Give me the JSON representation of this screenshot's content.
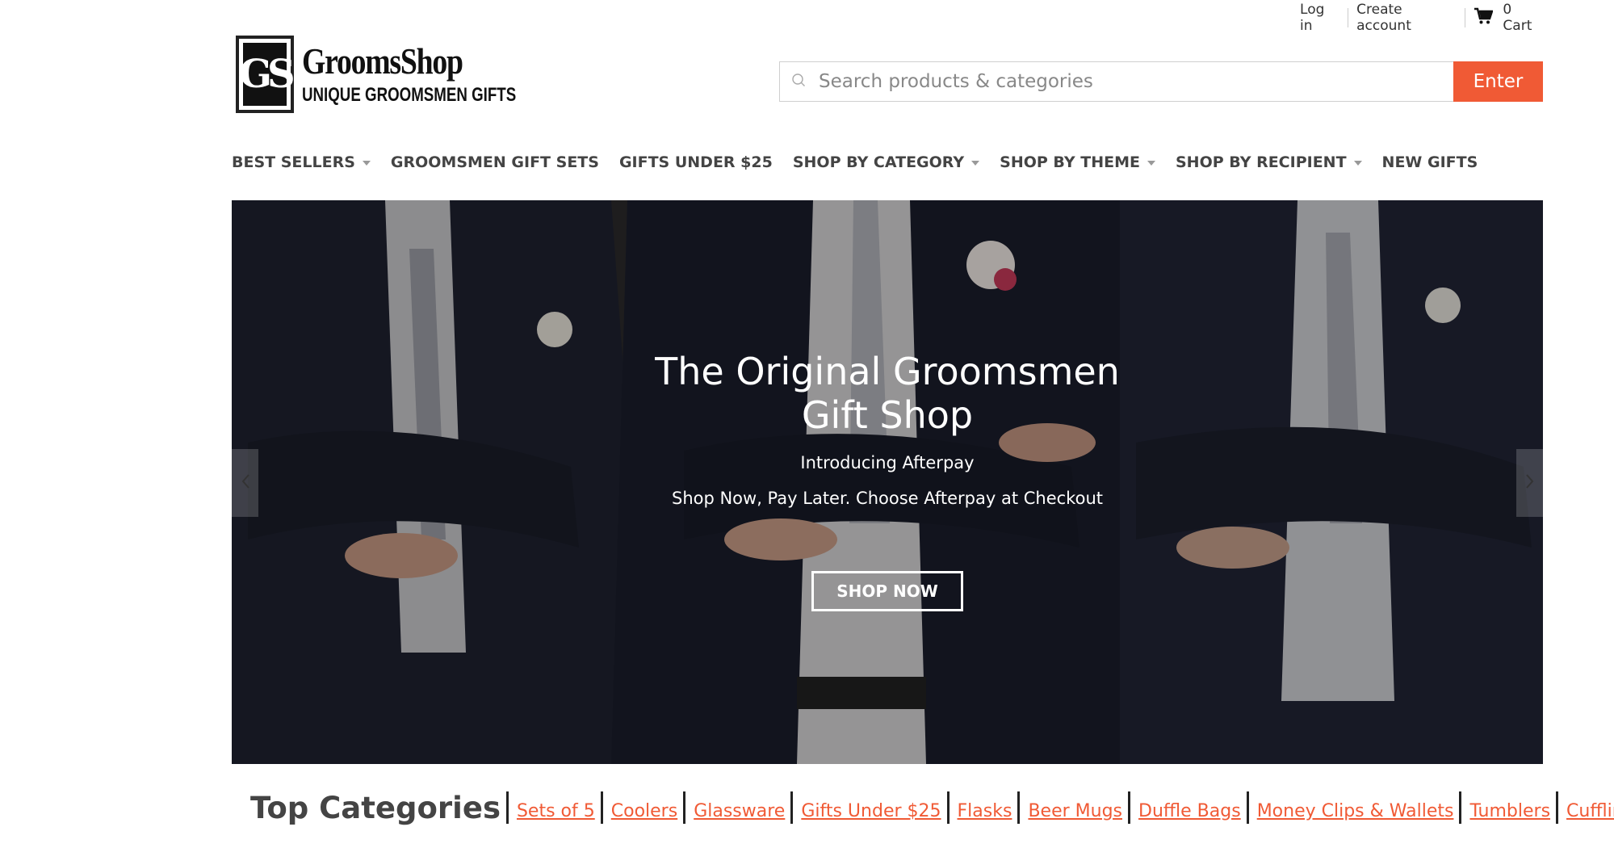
{
  "utility": {
    "login": "Log in",
    "create_account": "Create account",
    "cart_count": "0",
    "cart_label": "Cart"
  },
  "logo": {
    "mark": "GS",
    "name": "GroomsShop",
    "tagline": "UNIQUE GROOMSMEN GIFTS"
  },
  "search": {
    "placeholder": "Search products & categories",
    "button": "Enter"
  },
  "nav": {
    "items": [
      {
        "label": "BEST SELLERS",
        "dropdown": true
      },
      {
        "label": "GROOMSMEN GIFT SETS",
        "dropdown": false
      },
      {
        "label": "GIFTS UNDER $25",
        "dropdown": false
      },
      {
        "label": "SHOP BY CATEGORY",
        "dropdown": true
      },
      {
        "label": "SHOP BY THEME",
        "dropdown": true
      },
      {
        "label": "SHOP BY RECIPIENT",
        "dropdown": true
      },
      {
        "label": "NEW GIFTS",
        "dropdown": false
      }
    ]
  },
  "hero": {
    "title": "The Original Groomsmen Gift Shop",
    "subtitle": "Introducing Afterpay",
    "subtitle2": "Shop Now, Pay Later. Choose Afterpay at Checkout",
    "button": "SHOP NOW"
  },
  "top_categories": {
    "title": "Top Categories",
    "links": [
      "Sets of 5",
      "Coolers",
      "Glassware",
      "Gifts Under $25",
      "Flasks",
      "Beer Mugs",
      "Duffle Bags",
      "Money Clips & Wallets",
      "Tumblers",
      "Cufflinks"
    ]
  },
  "colors": {
    "accent": "#f05a35",
    "nav_text": "#444444",
    "hero_overlay": "#000000"
  },
  "icons": {
    "cart": "cart-icon",
    "search": "search-icon",
    "prev": "chevron-left-icon",
    "next": "chevron-right-icon"
  }
}
